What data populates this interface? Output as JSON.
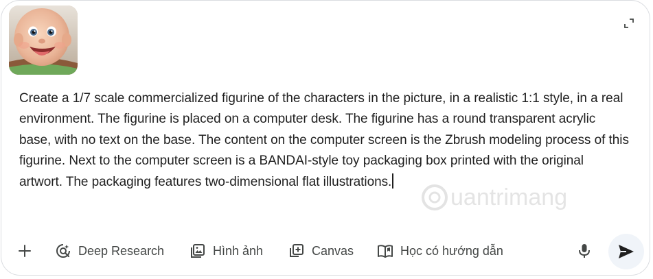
{
  "attachment": {
    "alt": "Laughing baby photo"
  },
  "prompt": {
    "text": "Create a 1/7 scale commercialized figurine of the characters in the picture, in a realistic 1:1 style, in a real environment. The figurine is placed on a computer desk. The figurine has a round transparent acrylic base, with no text on the base. The content on the computer screen is the Zbrush modeling process of this figurine. Next to the computer screen is a BANDAI-style toy packaging box printed with the original artwort. The packaging features two-dimensional flat illustrations."
  },
  "watermark": {
    "text": "uantrimang"
  },
  "toolbar": {
    "add_icon": "plus-icon",
    "tools": [
      {
        "label": "Deep Research",
        "icon": "deep-research-icon"
      },
      {
        "label": "Hình ảnh",
        "icon": "image-icon"
      },
      {
        "label": "Canvas",
        "icon": "canvas-icon"
      },
      {
        "label": "Học có hướng dẫn",
        "icon": "book-icon"
      }
    ],
    "mic_icon": "microphone-icon",
    "send_icon": "send-icon"
  },
  "colors": {
    "text": "#1f1f1f",
    "icon": "#444746",
    "border": "#dadce0",
    "send_bg": "#f0f4f9"
  }
}
